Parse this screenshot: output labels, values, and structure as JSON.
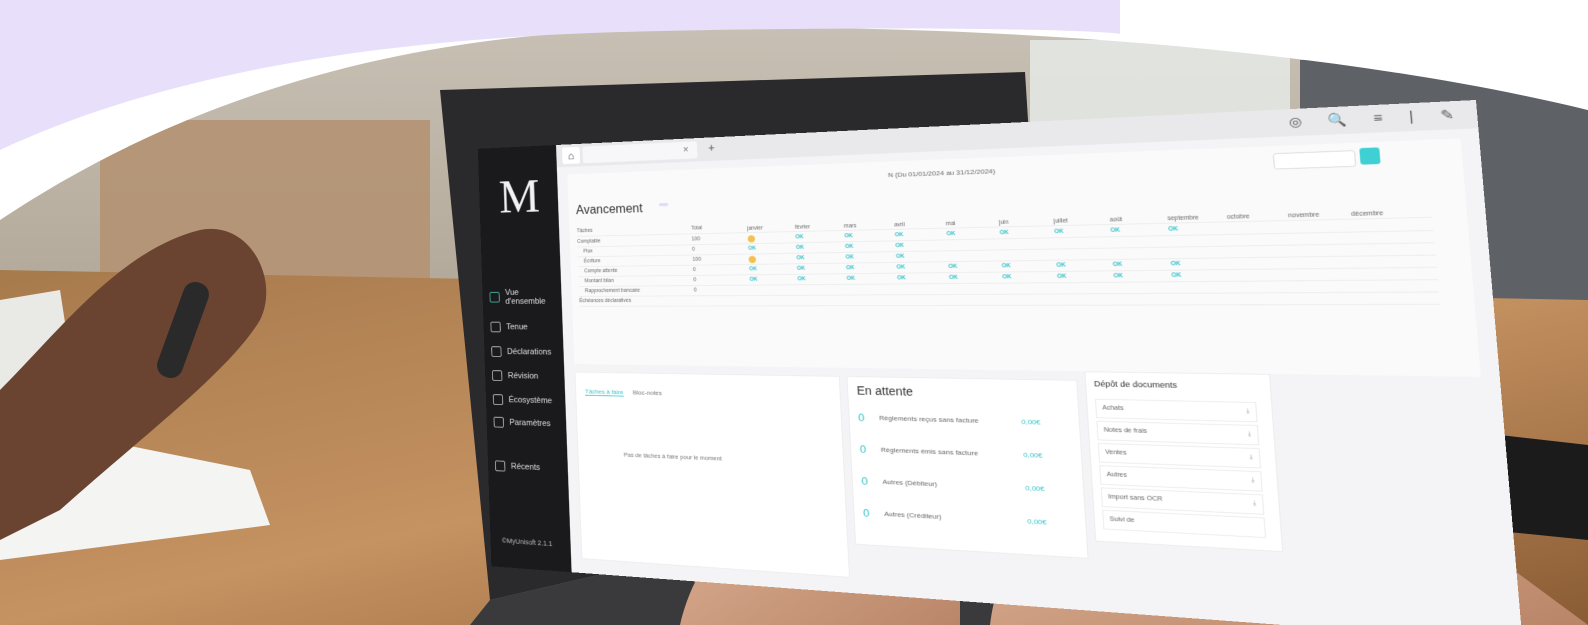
{
  "brand_colors": {
    "lavender": "#e8e0fb",
    "teal": "#35c3c8",
    "sidebar": "#1a1a1d"
  },
  "sidebar": {
    "logo": "M",
    "items": [
      {
        "icon": "grid-icon",
        "label": "Vue d'ensemble"
      },
      {
        "icon": "ledger-icon",
        "label": "Tenue"
      },
      {
        "icon": "document-icon",
        "label": "Déclarations"
      },
      {
        "icon": "calculator-icon",
        "label": "Révision"
      },
      {
        "icon": "ecosystem-icon",
        "label": "Écosystème"
      },
      {
        "icon": "sliders-icon",
        "label": "Paramètres"
      },
      {
        "icon": "back-arrow-icon",
        "label": "Récents"
      }
    ],
    "version": "©MyUnisoft 2.1.1"
  },
  "header": {
    "title": "Avancement",
    "period": "N (Du 01/01/2024 au 31/12/2024)"
  },
  "grid": {
    "col_header_left": "Tâches",
    "col_total": "Total",
    "months": [
      "janvier",
      "février",
      "mars",
      "avril",
      "mai",
      "juin",
      "juillet",
      "août",
      "septembre",
      "octobre",
      "novembre",
      "décembre"
    ],
    "ok_label": "OK",
    "rows": [
      {
        "label": "Comptable",
        "total": "100"
      },
      {
        "label": "Flux",
        "total": "0"
      },
      {
        "label": "Écriture",
        "total": "100"
      },
      {
        "label": "Compte attente",
        "total": "0"
      },
      {
        "label": "Montant bilan",
        "total": "0"
      },
      {
        "label": "Rapprochement bancaire",
        "total": "0"
      },
      {
        "label": "Échéances déclaratives",
        "total": ""
      }
    ]
  },
  "pending": {
    "title": "En attente",
    "items": [
      {
        "count": "0",
        "label": "Règlements reçus sans facture",
        "amount": "0,00€"
      },
      {
        "count": "0",
        "label": "Règlements émis sans facture",
        "amount": "0,00€"
      },
      {
        "count": "0",
        "label": "Autres (Débiteur)",
        "amount": "0,00€"
      },
      {
        "count": "0",
        "label": "Autres (Créditeur)",
        "amount": "0,00€"
      }
    ]
  },
  "documents": {
    "title": "Dépôt de documents",
    "items": [
      "Achats",
      "Notes de frais",
      "Ventes",
      "Autres",
      "Import sans OCR",
      "Suivi de"
    ]
  },
  "tasks": {
    "tab_active": "Tâches à faire",
    "tab_other": "Bloc-notes",
    "empty": "Pas de tâches à faire pour le moment"
  }
}
